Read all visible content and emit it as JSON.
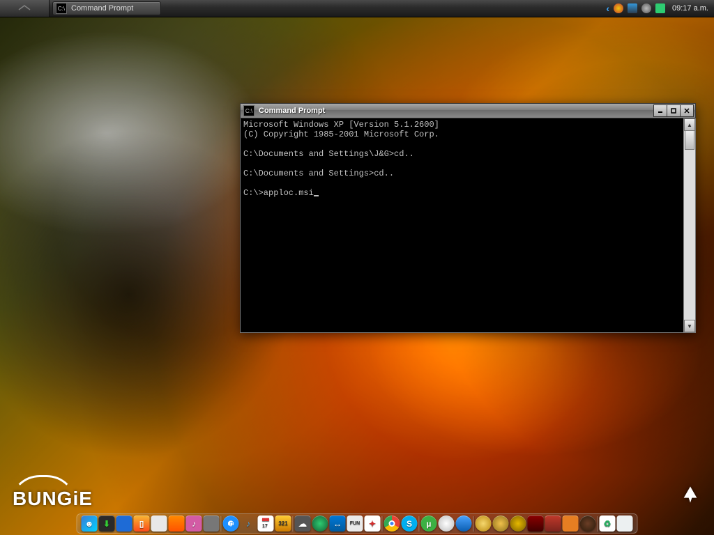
{
  "taskbar": {
    "task_label": "Command Prompt",
    "clock": "09:17 a.m.",
    "tray_icons": [
      "shield-icon",
      "network-icon",
      "volume-icon",
      "clock-icon",
      "app-icon"
    ]
  },
  "window": {
    "title": "Command Prompt",
    "terminal_lines": [
      "Microsoft Windows XP [Version 5.1.2600]",
      "(C) Copyright 1985-2001 Microsoft Corp.",
      "",
      "C:\\Documents and Settings\\J&G>cd..",
      "",
      "C:\\Documents and Settings>cd..",
      "",
      "C:\\>apploc.msi"
    ]
  },
  "branding": {
    "studio": "BUNGiE"
  },
  "dock_items": [
    {
      "name": "finder-icon",
      "bg": "linear-gradient(135deg,#3a7bd5,#00d2ff)"
    },
    {
      "name": "download-icon",
      "bg": "#2a2a2a"
    },
    {
      "name": "tile-blue-icon",
      "bg": "#1e6bd6"
    },
    {
      "name": "ibooks-icon",
      "bg": "linear-gradient(#f7b733,#fc4a1a)"
    },
    {
      "name": "downarrow-icon",
      "bg": "#e8e8e8"
    },
    {
      "name": "orange-app-icon",
      "bg": "linear-gradient(#ff8a00,#ff5200)"
    },
    {
      "name": "music-icon",
      "bg": "#d35ba5"
    },
    {
      "name": "blank-app-icon",
      "bg": "#777"
    },
    {
      "name": "separator-1",
      "bg": "transparent"
    },
    {
      "name": "itunes-icon",
      "bg": "radial-gradient(circle,#fff 25%,#1e90ff 26%)"
    },
    {
      "name": "note-icon",
      "bg": "#4aa3df"
    },
    {
      "name": "calendar-icon",
      "bg": "#fff"
    },
    {
      "name": "mpc-icon",
      "bg": "linear-gradient(#ffcc33,#cc7a00)"
    },
    {
      "name": "separator-2",
      "bg": "transparent"
    },
    {
      "name": "cloud-icon",
      "bg": "#555"
    },
    {
      "name": "green-disc-icon",
      "bg": "radial-gradient(circle,#2ecc71,#145a32)"
    },
    {
      "name": "teamviewer-icon",
      "bg": "linear-gradient(#0078d7,#005a9e)"
    },
    {
      "name": "fun-icon",
      "bg": "#eaeaea"
    },
    {
      "name": "maple-icon",
      "bg": "#d32f2f"
    },
    {
      "name": "separator-3",
      "bg": "transparent"
    },
    {
      "name": "chrome-icon",
      "bg": "conic-gradient(#ea4335 0 120deg,#fbbc05 120deg 240deg,#34a853 240deg 360deg)"
    },
    {
      "name": "skype-icon",
      "bg": "#00aff0"
    },
    {
      "name": "separator-4",
      "bg": "transparent"
    },
    {
      "name": "utorrent-icon",
      "bg": "#3cb043"
    },
    {
      "name": "disc-icon",
      "bg": "radial-gradient(circle,#fff,#bbb)"
    },
    {
      "name": "globe-icon",
      "bg": "linear-gradient(#4aa3ff,#0a5db0)"
    },
    {
      "name": "separator-5",
      "bg": "transparent"
    },
    {
      "name": "coin-icon",
      "bg": "radial-gradient(circle,#f5d76e,#b8860b)"
    },
    {
      "name": "gold2-icon",
      "bg": "radial-gradient(circle,#f0c14b,#8a6d1a)"
    },
    {
      "name": "gold3-icon",
      "bg": "radial-gradient(circle,#e6b800,#7a5c00)"
    },
    {
      "name": "red-app-icon",
      "bg": "linear-gradient(#8b0000,#400000)"
    },
    {
      "name": "book2-icon",
      "bg": "linear-gradient(#c0392b,#7b241c)"
    },
    {
      "name": "orange2-icon",
      "bg": "#e67e22"
    },
    {
      "name": "dark-disc-icon",
      "bg": "radial-gradient(circle,#6b3e26,#2a1a0a)"
    },
    {
      "name": "separator-6",
      "bg": "transparent"
    },
    {
      "name": "recycle-icon",
      "bg": "#27ae60"
    },
    {
      "name": "paper-icon",
      "bg": "#ecf0f1"
    }
  ]
}
